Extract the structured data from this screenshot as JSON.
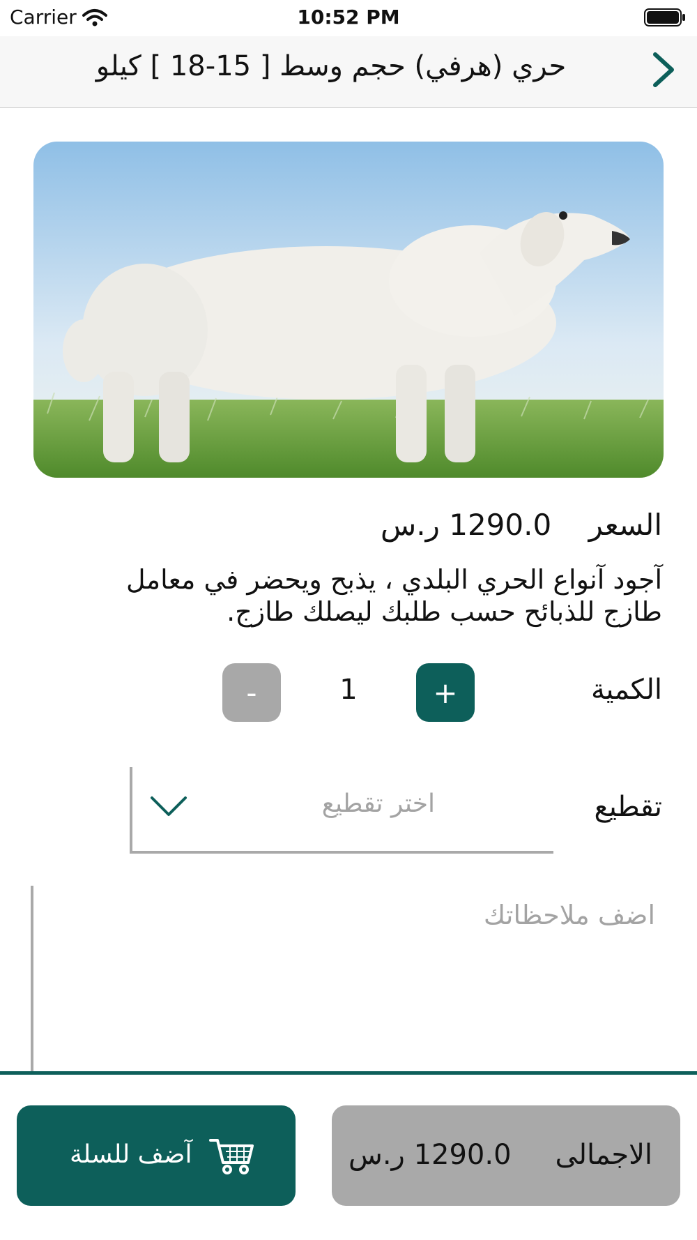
{
  "status_bar": {
    "carrier": "Carrier",
    "time": "10:52 PM"
  },
  "header": {
    "title": "حري (هرفي) حجم وسط [ 15-18 ] كيلو"
  },
  "product": {
    "price_label": "السعر",
    "price_value": "1290.0 ر.س",
    "description": "آجود آنواع الحري  البلدي ، يذبح ويحضر في معامل طازج للذبائح حسب طلبك ليصلك طازج."
  },
  "quantity": {
    "label": "الكمية",
    "value": "1",
    "plus": "+",
    "minus": "-"
  },
  "cutting": {
    "label": "تقطيع",
    "placeholder": "اختر تقطيع"
  },
  "notes": {
    "placeholder": "اضف ملاحظاتك"
  },
  "footer": {
    "add_to_cart": "آضف للسلة",
    "total_label": "الاجمالى",
    "total_value": "1290.0 ر.س"
  },
  "colors": {
    "accent": "#0d5f5a",
    "muted_button": "#a8a8a8"
  },
  "icons": [
    "wifi-icon",
    "battery-icon",
    "back-chevron-icon",
    "chevron-down-icon",
    "cart-icon"
  ]
}
